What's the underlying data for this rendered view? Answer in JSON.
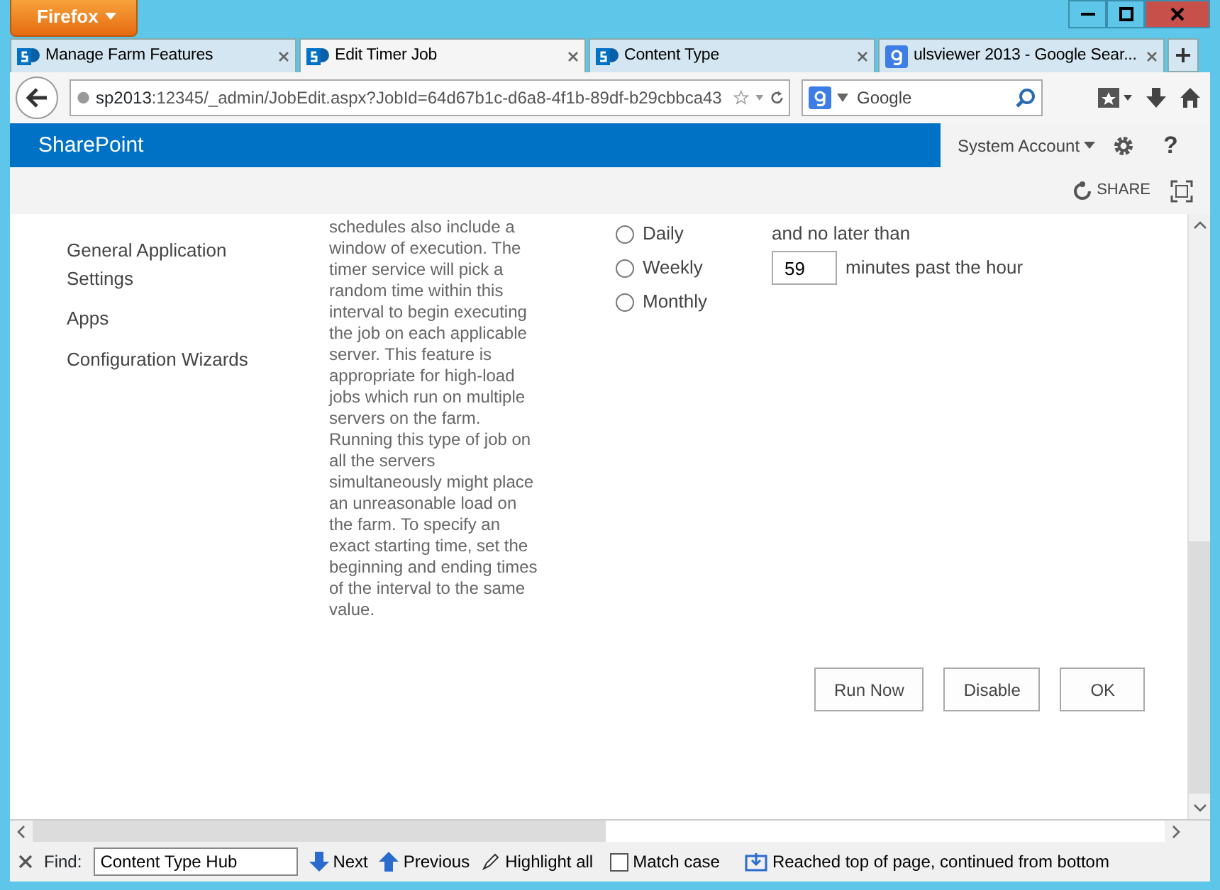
{
  "window": {
    "menu_button": "Firefox"
  },
  "tabs": [
    {
      "label": "Manage Farm Features",
      "kind": "sharepoint",
      "selected": false
    },
    {
      "label": "Edit Timer Job",
      "kind": "sharepoint",
      "selected": true
    },
    {
      "label": "Content Type",
      "kind": "sharepoint",
      "selected": false
    },
    {
      "label": "ulsviewer 2013 - Google Sear...",
      "kind": "google",
      "selected": false
    }
  ],
  "address_bar": {
    "host": "sp2013",
    "path": ":12345/_admin/JobEdit.aspx?JobId=64d67b1c-d6a8-4f1b-89df-b29cbbca43"
  },
  "search": {
    "placeholder": "Google"
  },
  "suite_bar": {
    "brand": "SharePoint",
    "user": "System Account",
    "help": "?"
  },
  "share": "SHARE",
  "sidebar": {
    "items": [
      "General Application Settings",
      "Apps",
      "Configuration Wizards"
    ]
  },
  "description": {
    "first_line": "schedules also include a",
    "text": "window of execution. The timer service will pick a random time within this interval to begin executing the job on each applicable server. This feature is appropriate for high-load jobs which run on multiple servers on the farm. Running this type of job on all the servers simultaneously might place an unreasonable load on the farm. To specify an exact starting time, set the beginning and ending times of the interval to the same value."
  },
  "schedule": {
    "options": [
      {
        "label": "Daily",
        "selected": false
      },
      {
        "label": "Weekly",
        "selected": false
      },
      {
        "label": "Monthly",
        "selected": false
      }
    ],
    "end_label": "and no later than",
    "minutes": "59",
    "minutes_label": "minutes past the hour"
  },
  "buttons": [
    "Run Now",
    "Disable",
    "OK"
  ],
  "find_bar": {
    "label": "Find:",
    "value": "Content Type Hub",
    "next": "Next",
    "previous": "Previous",
    "highlight": "Highlight all",
    "match_case": {
      "label": "Match case",
      "checked": false
    },
    "status": "Reached top of page, continued from bottom"
  }
}
